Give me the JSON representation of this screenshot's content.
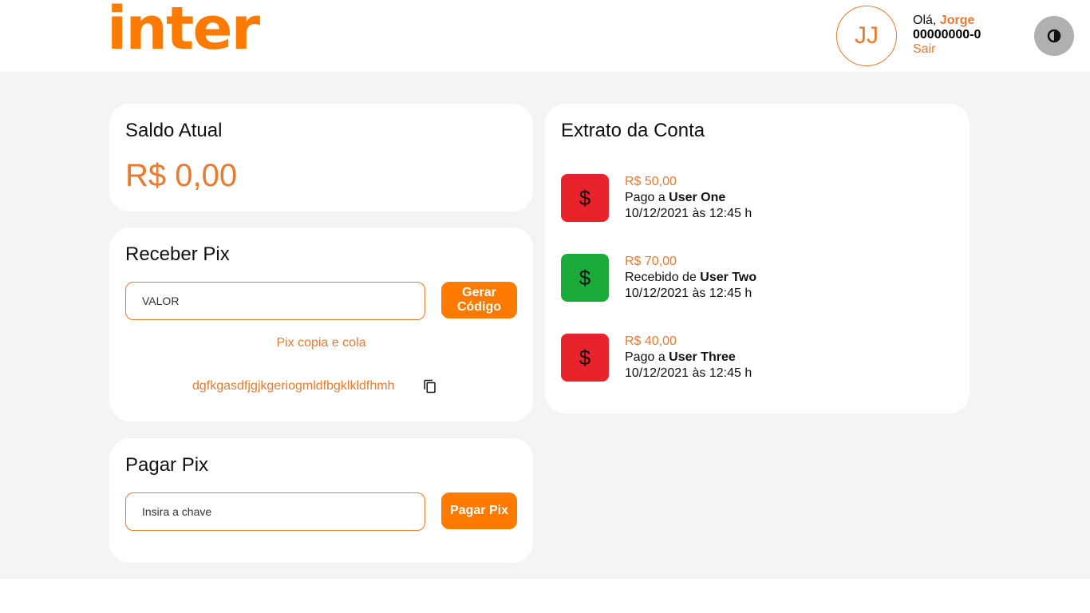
{
  "header": {
    "logo": "inter",
    "avatar_initials": "JJ",
    "greeting": "Olá, ",
    "user_name": "Jorge",
    "account_number": "00000000-0",
    "logout_label": "Sair",
    "theme_toggle_icon": "contrast-icon"
  },
  "balance": {
    "title": "Saldo Atual",
    "value": "R$ 0,00"
  },
  "receive_pix": {
    "title": "Receber Pix",
    "input_placeholder": "VALOR",
    "button_line1": "Gerar",
    "button_line2": "Código",
    "copy_label": "Pix copia e cola",
    "code": "dgfkgasdfjgjkgeriogmldfbgklkldfhmh",
    "copy_icon": "copy-icon"
  },
  "pay_pix": {
    "title": "Pagar Pix",
    "input_placeholder": "Insira a chave",
    "button_label": "Pagar Pix"
  },
  "statement": {
    "title": "Extrato da Conta",
    "transactions": [
      {
        "amount": "R$ 50,00",
        "prefix": "Pago a ",
        "user": "User One",
        "datetime": "10/12/2021 às 12:45 h",
        "icon": "dollar-icon",
        "color": "#e8232b"
      },
      {
        "amount": "R$ 70,00",
        "prefix": "Recebido de ",
        "user": "User Two",
        "datetime": "10/12/2021 às 12:45 h",
        "icon": "dollar-icon",
        "color": "#1aab3a"
      },
      {
        "amount": "R$ 40,00",
        "prefix": "Pago a ",
        "user": "User Three",
        "datetime": "10/12/2021 às 12:45 h",
        "icon": "dollar-icon",
        "color": "#e8232b"
      }
    ]
  },
  "colors": {
    "brand_orange": "#ff7a00",
    "text_orange": "#ea7a2e",
    "background": "#f4f4f6",
    "debit_red": "#e8232b",
    "credit_green": "#1aab3a"
  }
}
